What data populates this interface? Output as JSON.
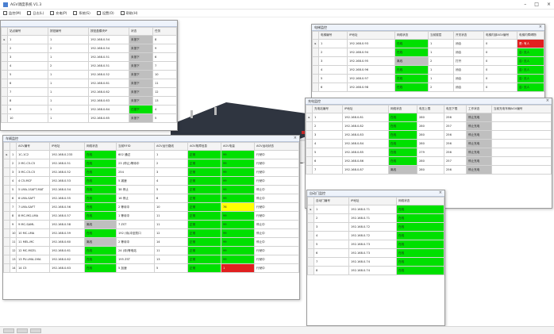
{
  "app": {
    "title": "AGV调度系统 V1.3"
  },
  "menu": [
    {
      "icon": "monitor-icon",
      "label": "监控(M)"
    },
    {
      "icon": "log-icon",
      "label": "日志(L)"
    },
    {
      "icon": "charge-icon",
      "label": "充电(P)"
    },
    {
      "icon": "system-icon",
      "label": "系统(S)"
    },
    {
      "icon": "settings-icon",
      "label": "设置(O)"
    },
    {
      "icon": "help-icon",
      "label": "帮助(H)"
    }
  ],
  "panel_stations": {
    "headers": [
      "站点编号",
      "按钮编号",
      "按钮盒模块IP",
      "状态",
      "任务"
    ],
    "rows": [
      [
        "1",
        "1",
        "192.168.0.54",
        "未按下",
        "8"
      ],
      [
        "2",
        "2",
        "192.168.0.54",
        "未按下",
        "9"
      ],
      [
        "3",
        "1",
        "192.168.0.51",
        "未按下",
        "6"
      ],
      [
        "4",
        "2",
        "192.168.0.51",
        "未按下",
        "7"
      ],
      [
        "5",
        "1",
        "192.168.0.52",
        "未按下",
        "10"
      ],
      [
        "6",
        "1",
        "192.168.0.61",
        "未按下",
        "11"
      ],
      [
        "7",
        "1",
        "192.168.0.62",
        "未按下",
        "12"
      ],
      [
        "8",
        "1",
        "192.168.0.63",
        "未按下",
        "13"
      ],
      [
        "9",
        "1",
        "192.168.0.64",
        "已按下",
        "4"
      ],
      [
        "10",
        "1",
        "192.168.0.65",
        "未按下",
        "5"
      ]
    ]
  },
  "panel_agv": {
    "title": "车辆监控",
    "headers": [
      "AGV编号",
      "IP地址",
      "网络状态",
      "当前RFID",
      "AGV运行路线",
      "AGV故障信息",
      "AGV电量",
      "AGV运动状态"
    ],
    "rows": [
      [
        "1",
        "1C-1C2",
        "192.168.0.233",
        "在线",
        "602 通过",
        "1",
        "正常",
        "99",
        "行驶中"
      ],
      [
        "2",
        "2 MC-C5-C5",
        "192.168.0.51",
        "在线",
        "23 (停止)等待中",
        "2",
        "正常",
        "99",
        "行驶中"
      ],
      [
        "3",
        "3 MC-C5-C5",
        "192.168.0.52",
        "在线",
        "254",
        "3",
        "正常",
        "99",
        "行驶中"
      ],
      [
        "4",
        "4 C5-MCF",
        "192.168.0.53",
        "在线",
        "5 减速",
        "4",
        "正常",
        "99",
        "行驶中"
      ],
      [
        "5",
        "5 LMA-1SAFT-MAT",
        "192.168.0.54",
        "在线",
        "38 停止",
        "5",
        "正常",
        "99",
        "停止中"
      ],
      [
        "6",
        "6 LMA-SAFT",
        "192.168.0.55",
        "在线",
        "16 停止",
        "6",
        "正常",
        "99",
        "停止中"
      ],
      [
        "7",
        "7 LMA-SAFT",
        "192.168.0.56",
        "在线",
        "2 等待中",
        "10",
        "正常",
        "76",
        "行驶中"
      ],
      [
        "8",
        "8 MC-MG-LMA",
        "192.168.0.57",
        "在线",
        "1 等待中",
        "11",
        "正常",
        "99",
        "行驶中"
      ],
      [
        "9",
        "9 MC-SAML",
        "192.168.0.58",
        "离线",
        "7 ZST",
        "11",
        "正常",
        "99",
        "停止中"
      ],
      [
        "10",
        "10 MC-LMA",
        "192.168.0.59",
        "在线",
        "192 (待)冲至防口",
        "12",
        "正常",
        "99",
        "停止中"
      ],
      [
        "11",
        "11 MEL-MC",
        "192.168.0.60",
        "离线",
        "2 等待中",
        "14",
        "正常",
        "99",
        "停止中"
      ],
      [
        "12",
        "12 MC-MCEL",
        "192.168.0.61",
        "在线",
        "24 (待)等电站",
        "11",
        "正常",
        "99",
        "行驶中"
      ],
      [
        "13",
        "13 PU-LMA-1MA",
        "192.168.0.62",
        "在线",
        "195 ZST",
        "13",
        "正常",
        "99",
        "行驶中"
      ],
      [
        "14",
        "14 C5",
        "192.168.0.63",
        "在线",
        "5 加速",
        "5",
        "正常",
        "1",
        "行驶中"
      ]
    ]
  },
  "panel_elevator": {
    "title": "电梯监控",
    "headers": [
      "电梯编号",
      "IP地址",
      "网络状态",
      "当前楼层",
      "开关状态",
      "电梯内部AGV编号",
      "电梯内障碍物"
    ],
    "rows": [
      [
        "1",
        "192.168.0.93",
        "在线",
        "1",
        "闭合",
        "0",
        "是: 有人"
      ],
      [
        "2",
        "192.168.0.94",
        "在线",
        "1",
        "闭合",
        "0",
        "否: 无人"
      ],
      [
        "3",
        "192.168.0.95",
        "离线",
        "2",
        "打开",
        "0",
        "否: 无人"
      ],
      [
        "4",
        "192.168.0.96",
        "在线",
        "1",
        "闭合",
        "0",
        "否: 无人"
      ],
      [
        "5",
        "192.168.0.97",
        "在线",
        "1",
        "闭合",
        "0",
        "否: 无人"
      ],
      [
        "6",
        "192.168.0.98",
        "在线",
        "2",
        "闭合",
        "0",
        "否: 无人"
      ]
    ]
  },
  "panel_charger": {
    "title": "充电监控",
    "headers": [
      "充电站编号",
      "IP地址",
      "网络状态",
      "电压上限",
      "电压下限",
      "工作状态",
      "当前充电车辆AGV编号"
    ],
    "rows": [
      [
        "1",
        "192.168.0.81",
        "在线",
        "280",
        "256",
        "停止充电",
        ""
      ],
      [
        "2",
        "192.168.0.82",
        "在线",
        "280",
        "257",
        "停止充电",
        ""
      ],
      [
        "3",
        "192.168.0.83",
        "在线",
        "280",
        "256",
        "停止充电",
        ""
      ],
      [
        "4",
        "192.168.0.84",
        "在线",
        "280",
        "256",
        "停止充电",
        ""
      ],
      [
        "5",
        "192.168.0.85",
        "在线",
        "279",
        "256",
        "停止充电",
        ""
      ],
      [
        "6",
        "192.168.0.86",
        "在线",
        "280",
        "257",
        "停止充电",
        ""
      ],
      [
        "7",
        "192.168.0.87",
        "离线",
        "280",
        "256",
        "停止充电",
        ""
      ]
    ]
  },
  "panel_door": {
    "title": "自动门监控",
    "headers": [
      "自动门编号",
      "IP地址",
      "网络状态"
    ],
    "rows": [
      [
        "1",
        "192.168.0.71",
        "在线"
      ],
      [
        "2",
        "192.168.0.71",
        "在线"
      ],
      [
        "3",
        "192.168.0.72",
        "在线"
      ],
      [
        "4",
        "192.168.0.72",
        "在线"
      ],
      [
        "5",
        "192.168.0.73",
        "在线"
      ],
      [
        "6",
        "192.168.0.73",
        "在线"
      ],
      [
        "7",
        "192.168.0.74",
        "在线"
      ],
      [
        "8",
        "192.168.0.74",
        "在线"
      ]
    ]
  },
  "colors": {
    "online": "#00e000",
    "offline": "#bfbfbf",
    "alert": "#e02020",
    "warning": "#ffff00"
  }
}
